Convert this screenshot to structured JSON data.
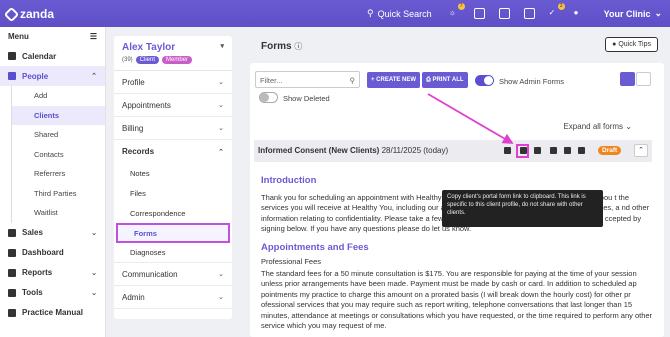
{
  "topbar": {
    "logo": "zanda",
    "quick_search": "Quick Search",
    "clinic": "Your Clinic",
    "badge1": "7",
    "badge2": "3"
  },
  "sidebar": {
    "menu": "Menu",
    "calendar": "Calendar",
    "people": "People",
    "people_sub": [
      "Add",
      "Clients",
      "Shared",
      "Contacts",
      "Referrers",
      "Third Parties",
      "Waitlist"
    ],
    "sales": "Sales",
    "dashboard": "Dashboard",
    "reports": "Reports",
    "tools": "Tools",
    "practice_manual": "Practice Manual"
  },
  "client": {
    "name": "Alex Taylor",
    "count": "(39)",
    "tag_client": "Client",
    "tag_member": "Member",
    "nav": [
      "Profile",
      "Appointments",
      "Billing"
    ],
    "records": "Records",
    "records_sub": [
      "Notes",
      "Files",
      "Correspondence",
      "Forms",
      "Diagnoses"
    ],
    "communication": "Communication",
    "admin": "Admin"
  },
  "main": {
    "title": "Forms",
    "quick_tips": "Quick Tips",
    "filter_placeholder": "Filter...",
    "create_new": "+ CREATE NEW",
    "print_all": "PRINT ALL",
    "show_admin": "Show Admin Forms",
    "show_deleted": "Show Deleted",
    "expand_all": "Expand all forms",
    "form_title": "Informed Consent (New Clients)",
    "form_date": "28/11/2025 (today)",
    "draft": "Draft",
    "tooltip": "Copy client's portal form link to clipboard. This link is specific to this client profile, do not share with other clients.",
    "intro_heading": "Introduction",
    "intro_text": "Thank you for scheduling an appointment with Healthy You. This form includes important information abou t the services you will receive at Healthy You, including our approach to treatment, our business practices, fees, a nd other information relating to confidentiality. Please take a few moments to read through these and indicated a ccepted by signing below. If you have any questions please do let us know.",
    "fees_heading": "Appointments and Fees",
    "fees_sub": "Professional Fees",
    "fees_text": "The standard fees for a 50 minute consultation is $175. You are responsible for paying at the time of your session unless prior arrangements have been made. Payment must be made by cash or card. In addition to scheduled ap pointments my practice to charge this amount on a prorated basis (I will break down the hourly cost) for other pr ofessional services that you may require such as report writing, telephone conversations that last longer than 15 minutes, attendance at meetings or consultations which you have requested, or the time required to perform any other service which you may request of me."
  },
  "colors": {
    "brand": "#6b5bd2",
    "draft": "#f0861d",
    "highlight": "#e040d0"
  }
}
